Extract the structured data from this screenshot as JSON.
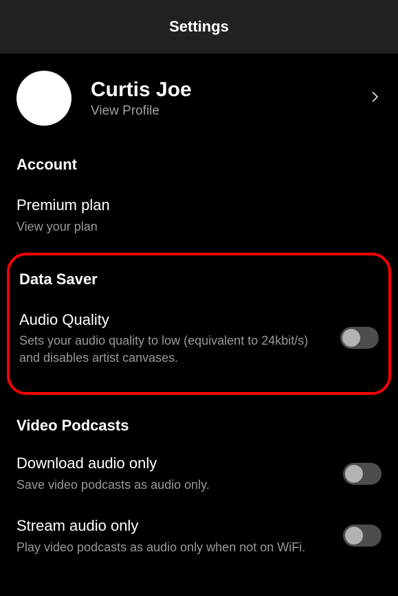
{
  "header": {
    "title": "Settings"
  },
  "profile": {
    "name": "Curtis Joe",
    "sub": "View Profile"
  },
  "sections": {
    "account": {
      "header": "Account",
      "premium": {
        "title": "Premium plan",
        "desc": "View your plan"
      }
    },
    "dataSaver": {
      "header": "Data Saver",
      "audioQuality": {
        "title": "Audio Quality",
        "desc": "Sets your audio quality to low (equivalent to 24kbit/s) and disables artist canvases."
      }
    },
    "videoPodcasts": {
      "header": "Video Podcasts",
      "downloadAudio": {
        "title": "Download audio only",
        "desc": "Save video podcasts as audio only."
      },
      "streamAudio": {
        "title": "Stream audio only",
        "desc": "Play video podcasts as audio only when not on WiFi."
      }
    }
  }
}
